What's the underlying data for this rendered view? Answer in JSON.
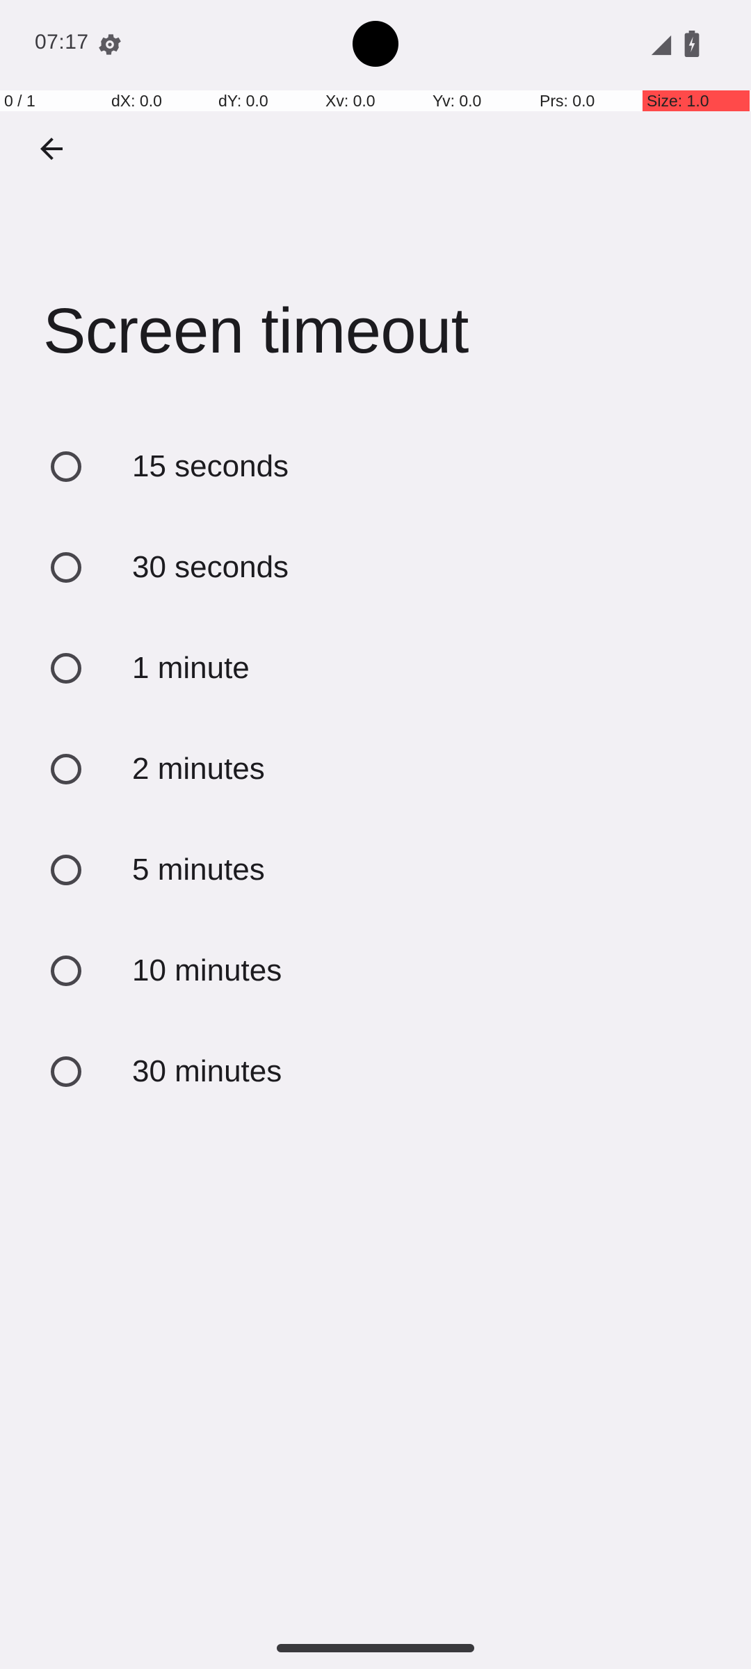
{
  "status_bar": {
    "time": "07:17",
    "settings_icon": "gear-icon",
    "signal_icon": "cellular-signal-icon",
    "battery_icon": "battery-charging-icon"
  },
  "pointer_overlay": {
    "pointer": "0 / 1",
    "dx": "dX: 0.0",
    "dy": "dY: 0.0",
    "xv": "Xv: 0.0",
    "yv": "Yv: 0.0",
    "prs": "Prs: 0.0",
    "size": "Size: 1.0"
  },
  "app_bar": {
    "back_icon": "arrow-back-icon"
  },
  "page": {
    "title": "Screen timeout"
  },
  "options": [
    {
      "label": "15 seconds"
    },
    {
      "label": "30 seconds"
    },
    {
      "label": "1 minute"
    },
    {
      "label": "2 minutes"
    },
    {
      "label": "5 minutes"
    },
    {
      "label": "10 minutes"
    },
    {
      "label": "30 minutes"
    }
  ],
  "colors": {
    "background": "#f2f0f4",
    "text": "#1c1b1f",
    "radio_outline": "#48464c",
    "overlay_highlight": "#ff4a4a"
  }
}
